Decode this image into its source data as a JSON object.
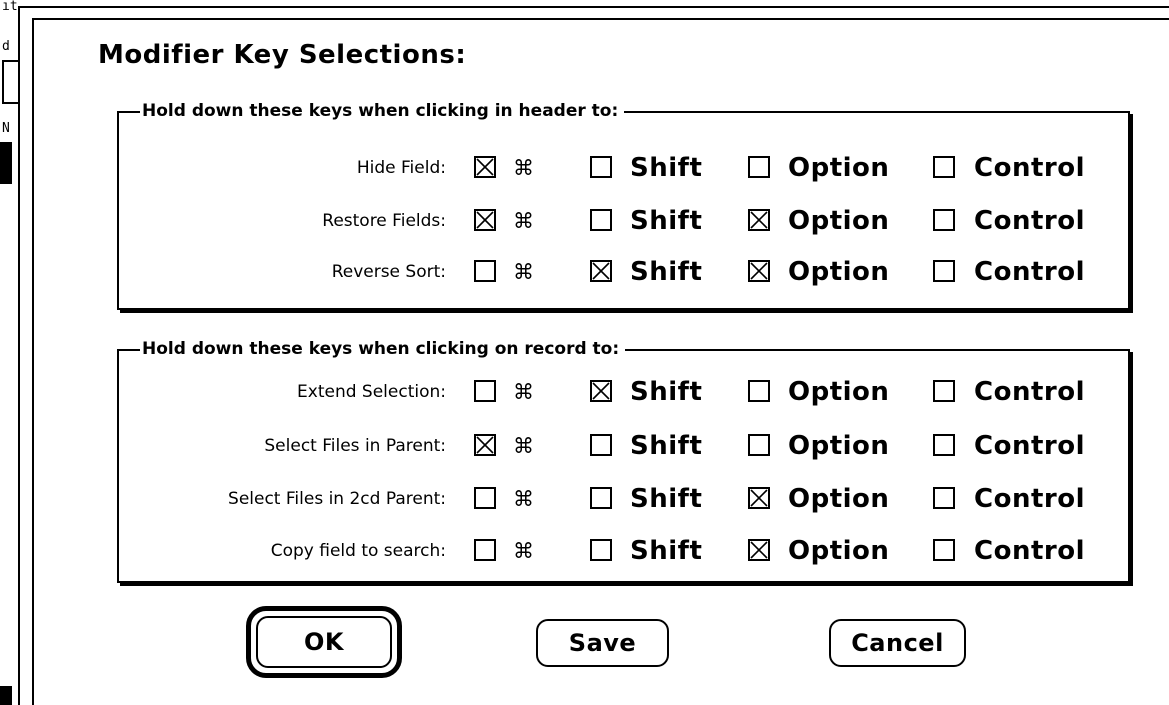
{
  "background": {
    "fragments": [
      "ıt",
      "d",
      "N",
      "≡"
    ]
  },
  "dialog": {
    "title": "Modifier Key Selections:",
    "key_labels": {
      "cmd": "⌘",
      "shift": "Shift",
      "option": "Option",
      "control": "Control"
    },
    "groups": [
      {
        "title": "Hold down these keys when clicking in header to:",
        "rows": [
          {
            "label": "Hide Field:",
            "cmd": true,
            "shift": false,
            "option": false,
            "control": false
          },
          {
            "label": "Restore Fields:",
            "cmd": true,
            "shift": false,
            "option": true,
            "control": false
          },
          {
            "label": "Reverse Sort:",
            "cmd": false,
            "shift": true,
            "option": true,
            "control": false
          }
        ]
      },
      {
        "title": "Hold down these keys when clicking on record to:",
        "rows": [
          {
            "label": "Extend Selection:",
            "cmd": false,
            "shift": true,
            "option": false,
            "control": false
          },
          {
            "label": "Select Files in Parent:",
            "cmd": true,
            "shift": false,
            "option": false,
            "control": false
          },
          {
            "label": "Select Files in 2cd Parent:",
            "cmd": false,
            "shift": false,
            "option": true,
            "control": false
          },
          {
            "label": "Copy field to search:",
            "cmd": false,
            "shift": false,
            "option": true,
            "control": false
          }
        ]
      }
    ],
    "buttons": {
      "ok": "OK",
      "save": "Save",
      "cancel": "Cancel"
    }
  }
}
